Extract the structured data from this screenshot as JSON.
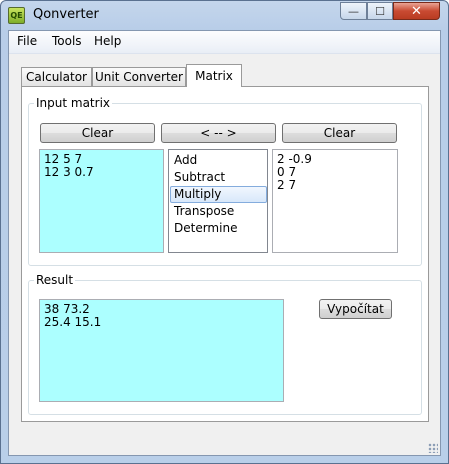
{
  "window": {
    "title": "Qonverter",
    "app_icon_text": "QE",
    "controls": {
      "minimize": "—",
      "maximize": "☐",
      "close": "✕"
    }
  },
  "menu": {
    "items": [
      "File",
      "Tools",
      "Help"
    ]
  },
  "tabs": [
    {
      "label": "Calculator",
      "active": false
    },
    {
      "label": "Unit Converter",
      "active": false
    },
    {
      "label": "Matrix",
      "active": true
    }
  ],
  "input_matrix": {
    "title": "Input matrix",
    "clear_left_label": "Clear",
    "swap_label": "< -- >",
    "clear_right_label": "Clear",
    "left_value": "12 5 7\n12 3 0.7",
    "right_value": "2 -0.9\n0 7\n2 7",
    "operations": [
      "Add",
      "Subtract",
      "Multiply",
      "Transpose",
      "Determine"
    ],
    "selected_operation": "Multiply"
  },
  "result": {
    "title": "Result",
    "value": "38 73.2\n25.4 15.1",
    "compute_label": "Vypočítat"
  },
  "colors": {
    "input_bg": "#acffff",
    "selection_border": "#84acdd"
  }
}
